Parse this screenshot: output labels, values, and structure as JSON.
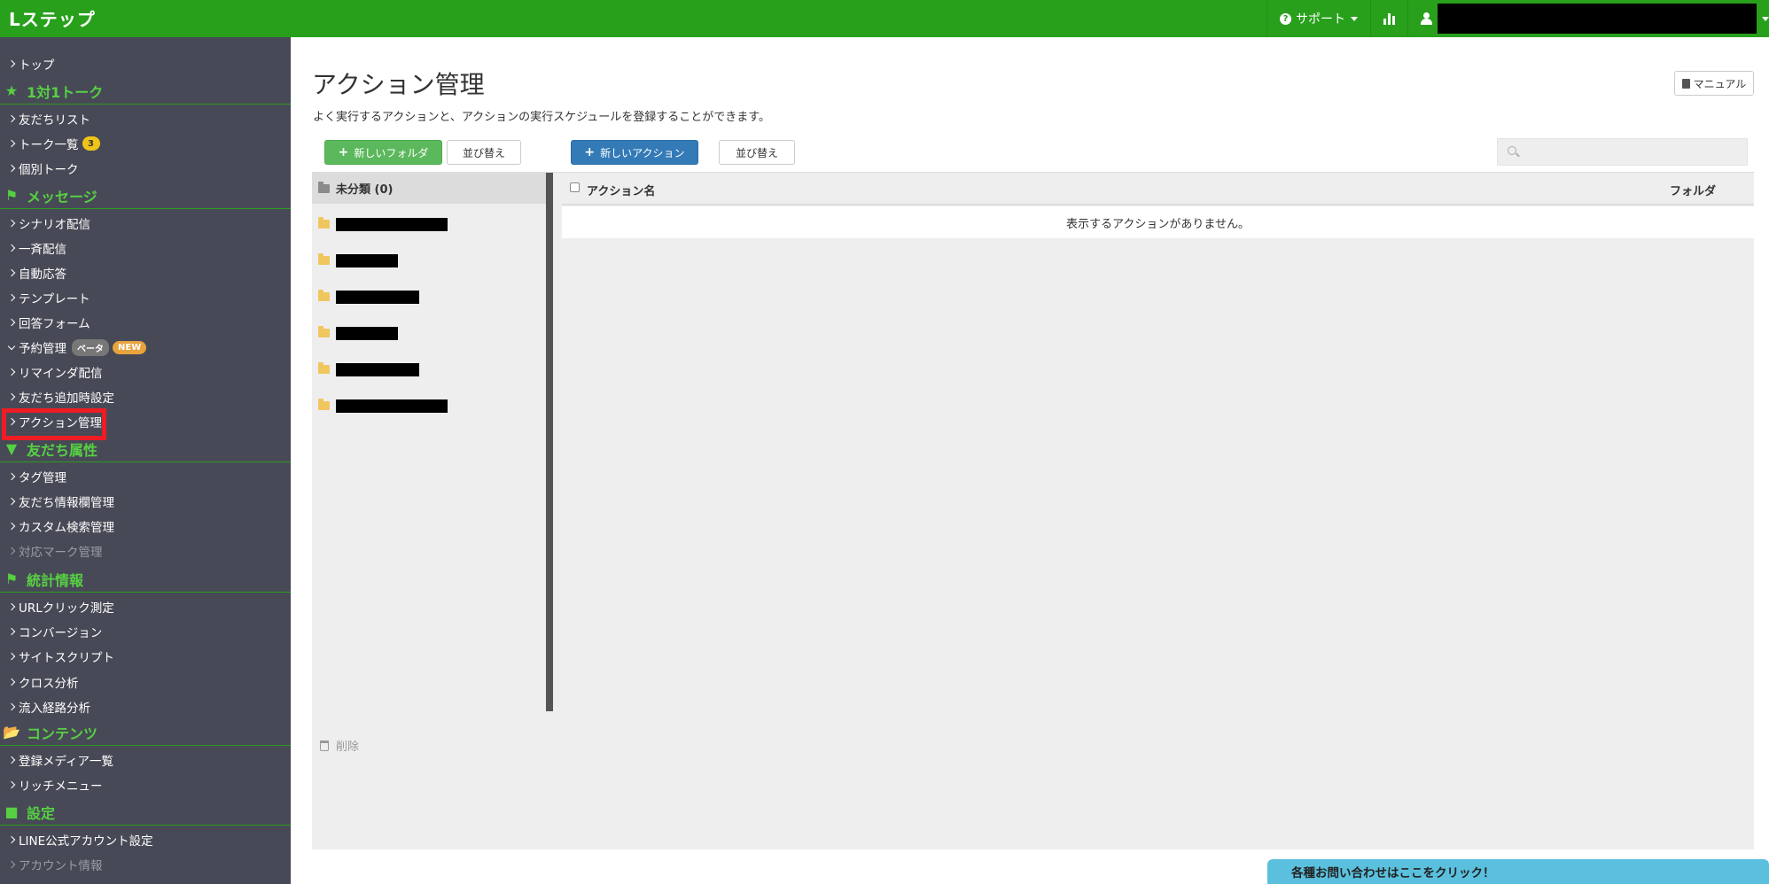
{
  "header": {
    "brand": "Lステップ",
    "support_label": "サポート",
    "icons": [
      "help-icon",
      "bar-chart-icon",
      "user-icon"
    ]
  },
  "sidebar": {
    "top": "トップ",
    "sections": [
      {
        "heading": "1対1トーク",
        "icon": "star-icon",
        "items": [
          {
            "label": "友だちリスト"
          },
          {
            "label": "トーク一覧",
            "badge": "3"
          },
          {
            "label": "個別トーク"
          }
        ]
      },
      {
        "heading": "メッセージ",
        "icon": "megaphone-icon",
        "items": [
          {
            "label": "シナリオ配信"
          },
          {
            "label": "一斉配信"
          },
          {
            "label": "自動応答"
          },
          {
            "label": "テンプレート"
          },
          {
            "label": "回答フォーム"
          },
          {
            "label": "予約管理",
            "beta": "ベータ",
            "new": "NEW"
          },
          {
            "label": "リマインダ配信"
          },
          {
            "label": "友だち追加時設定"
          },
          {
            "label": "アクション管理",
            "active": true
          }
        ]
      },
      {
        "heading": "友だち属性",
        "icon": "filter-icon",
        "items": [
          {
            "label": "タグ管理"
          },
          {
            "label": "友だち情報欄管理"
          },
          {
            "label": "カスタム検索管理"
          },
          {
            "label": "対応マーク管理",
            "disabled": true
          }
        ]
      },
      {
        "heading": "統計情報",
        "icon": "flag-icon",
        "items": [
          {
            "label": "URLクリック測定"
          },
          {
            "label": "コンバージョン"
          },
          {
            "label": "サイトスクリプト"
          },
          {
            "label": "クロス分析"
          },
          {
            "label": "流入経路分析"
          }
        ]
      },
      {
        "heading": "コンテンツ",
        "icon": "folder-open-icon",
        "items": [
          {
            "label": "登録メディア一覧"
          },
          {
            "label": "リッチメニュー"
          }
        ]
      },
      {
        "heading": "設定",
        "icon": "comment-icon",
        "items": [
          {
            "label": "LINE公式アカウント設定"
          },
          {
            "label": "アカウント情報",
            "disabled": true
          }
        ]
      }
    ]
  },
  "main": {
    "title": "アクション管理",
    "description": "よく実行するアクションと、アクションの実行スケジュールを登録することができます。",
    "manual_label": "マニュアル",
    "new_folder_label": "新しいフォルダ",
    "sort_label": "並び替え",
    "new_action_label": "新しいアクション",
    "sort_label_2": "並び替え",
    "search_placeholder": "",
    "folders": {
      "selected": "未分類 (0)",
      "redacted_count": 6
    },
    "table": {
      "col_name": "アクション名",
      "col_folder": "フォルダ",
      "empty_message": "表示するアクションがありません。"
    },
    "delete_label": "削除",
    "contact_label": "各種お問い合わせはここをクリック！"
  },
  "colors": {
    "header": "#28a01c",
    "sidebar": "#474a56",
    "section_heading": "#57d043",
    "highlight": "#ee1c25",
    "btn_green": "#5cb85c",
    "btn_blue": "#337ab7",
    "contact_tab": "#5bc0de"
  }
}
